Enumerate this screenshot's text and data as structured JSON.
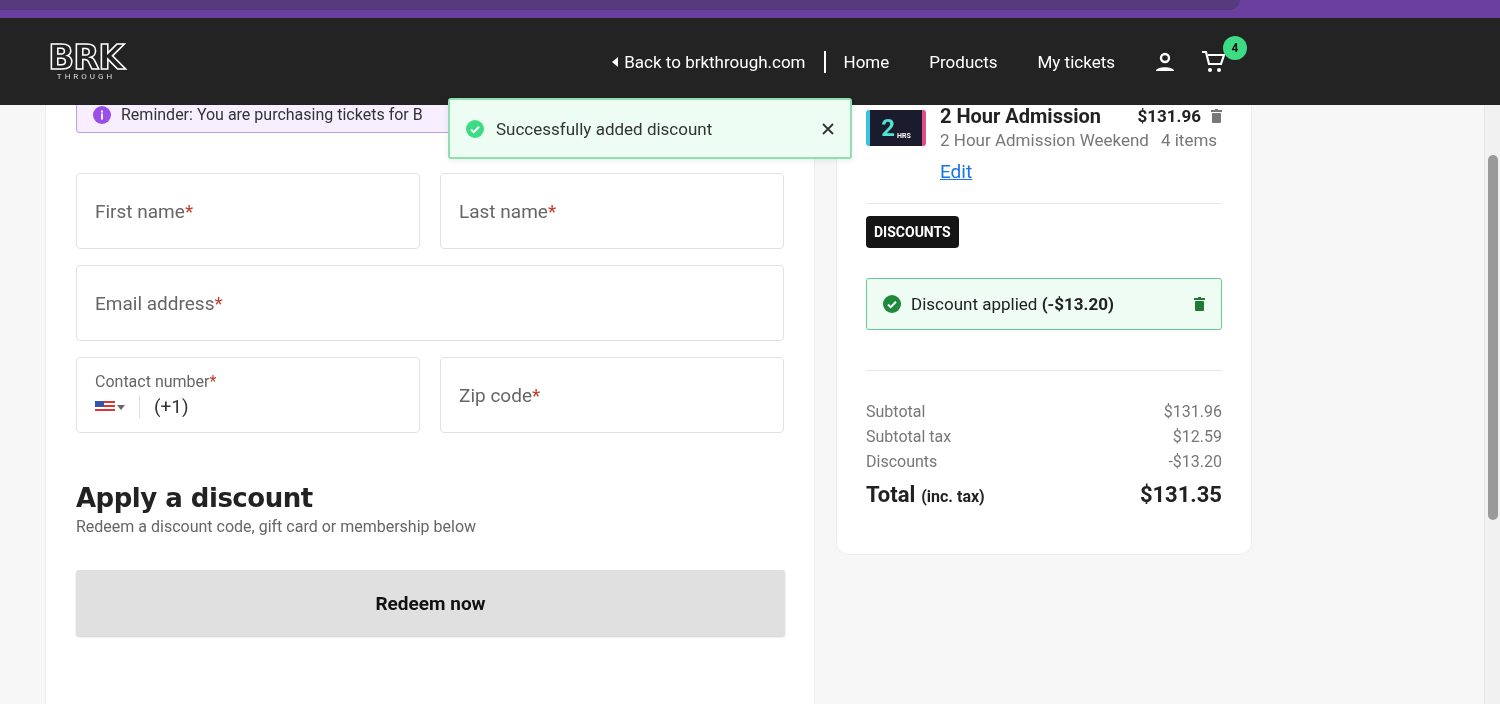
{
  "header": {
    "logo": {
      "word": "BRK",
      "sub": "THROUGH"
    },
    "back_link": "Back to brkthrough.com",
    "nav": [
      "Home",
      "Products",
      "My tickets"
    ],
    "cart_count": "4"
  },
  "reminder": "Reminder: You are purchasing tickets for B",
  "toast": {
    "message": "Successfully added discount"
  },
  "form": {
    "fields": [
      {
        "kind": "text",
        "label": "First name",
        "required_mark": "*"
      },
      {
        "kind": "text",
        "label": "Last name",
        "required_mark": "*"
      },
      {
        "kind": "wide",
        "label": "Email address",
        "required_mark": "*"
      },
      {
        "kind": "phone",
        "label": "Contact number",
        "required_mark": "*",
        "value": "(+1)"
      },
      {
        "kind": "text",
        "label": "Zip code",
        "required_mark": "*"
      }
    ]
  },
  "discount_section": {
    "title": "Apply a discount",
    "subtitle": "Redeem a discount code, gift card or membership below",
    "button": "Redeem now"
  },
  "cart": {
    "item": {
      "name": "2 Hour Admission",
      "price": "$131.96",
      "variant": "2 Hour Admission Weekend",
      "quantity": "4 items",
      "edit": "Edit",
      "thumb_number": "2",
      "thumb_sub": "HRS"
    },
    "discounts_tag": "DISCOUNTS",
    "discount_applied": "Discount applied **(-$13.20)**",
    "summary": [
      {
        "label": "Subtotal",
        "value": "$131.96"
      },
      {
        "label": "Subtotal tax",
        "value": "$12.59"
      },
      {
        "label": "Discounts",
        "value": "-$13.20"
      }
    ],
    "total": {
      "label": "Total",
      "note": "(inc. tax)",
      "value": "$131.35"
    }
  }
}
